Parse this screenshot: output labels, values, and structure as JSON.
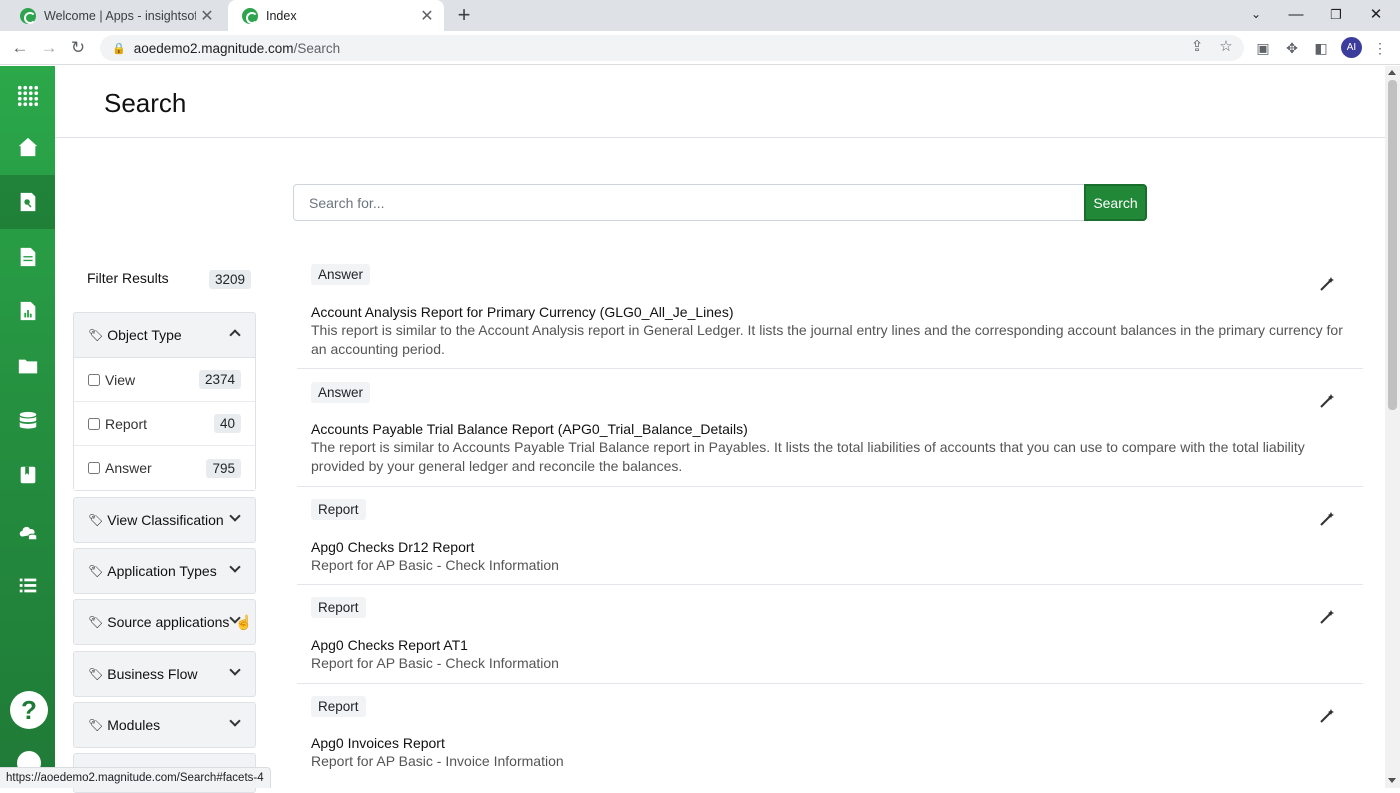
{
  "browser": {
    "tabs": [
      {
        "title": "Welcome | Apps - insightsoftware",
        "active": false
      },
      {
        "title": "Index",
        "active": true
      }
    ],
    "url_host": "aoedemo2.magnitude.com",
    "url_path": "/Search",
    "profile_initials": "AI",
    "status_url": "https://aoedemo2.magnitude.com/Search#facets-4"
  },
  "sidebar": {
    "items": [
      {
        "icon": "apps-grid-icon"
      },
      {
        "icon": "home-icon"
      },
      {
        "icon": "search-doc-icon",
        "active": true
      },
      {
        "icon": "document-icon"
      },
      {
        "icon": "report-chart-icon"
      },
      {
        "icon": "folder-icon"
      },
      {
        "icon": "database-icon"
      },
      {
        "icon": "bookmark-icon"
      },
      {
        "icon": "cloud-db-icon"
      },
      {
        "icon": "list-icon"
      }
    ],
    "help_label": "?"
  },
  "page": {
    "title": "Search"
  },
  "search": {
    "placeholder": "Search for...",
    "button_label": "Search"
  },
  "filters": {
    "heading": "Filter Results",
    "total": "3209",
    "facets": [
      {
        "label": "Object Type",
        "expanded": true,
        "options": [
          {
            "label": "View",
            "count": "2374"
          },
          {
            "label": "Report",
            "count": "40"
          },
          {
            "label": "Answer",
            "count": "795"
          }
        ]
      },
      {
        "label": "View Classification",
        "expanded": false
      },
      {
        "label": "Application Types",
        "expanded": false
      },
      {
        "label": "Source applications",
        "expanded": false
      },
      {
        "label": "Business Flow",
        "expanded": false
      },
      {
        "label": "Modules",
        "expanded": false
      }
    ]
  },
  "results": [
    {
      "type": "Answer",
      "title": "Account Analysis Report for Primary Currency (GLG0_All_Je_Lines)",
      "description": "This report is similar to the Account Analysis report in General Ledger. It lists the journal entry lines and the corresponding account balances in the primary currency for an accounting period."
    },
    {
      "type": "Answer",
      "title": "Accounts Payable Trial Balance Report (APG0_Trial_Balance_Details)",
      "description": "The report is similar to Accounts Payable Trial Balance report in Payables. It lists the total liabilities of accounts that you can use to compare with the total liability provided by your general ledger and reconcile the balances."
    },
    {
      "type": "Report",
      "title": "Apg0 Checks Dr12 Report",
      "description": "Report for AP Basic - Check Information"
    },
    {
      "type": "Report",
      "title": "Apg0 Checks Report AT1",
      "description": "Report for AP Basic - Check Information"
    },
    {
      "type": "Report",
      "title": "Apg0 Invoices Report",
      "description": "Report for AP Basic - Invoice Information"
    }
  ],
  "colors": {
    "brand_green": "#2ba84a",
    "button_green": "#218838"
  }
}
